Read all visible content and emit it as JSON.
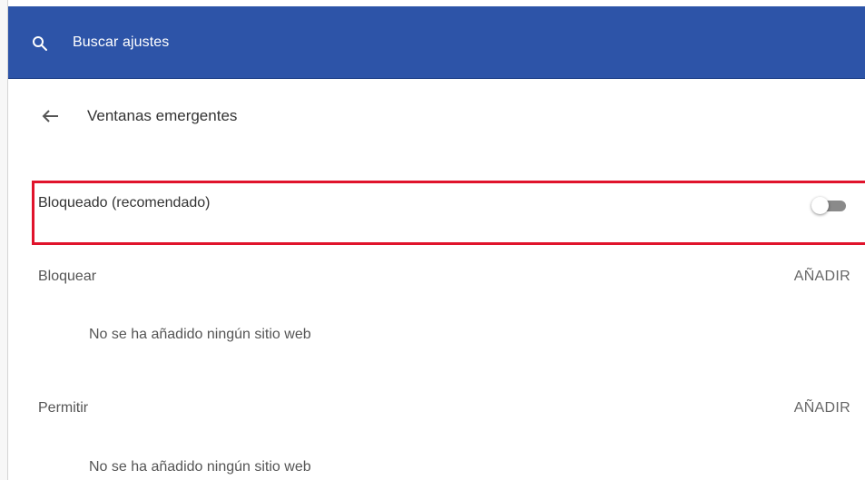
{
  "search": {
    "placeholder": "Buscar ajustes"
  },
  "page": {
    "title": "Ventanas emergentes"
  },
  "setting": {
    "label": "Bloqueado (recomendado)",
    "toggle_on": false
  },
  "sections": [
    {
      "label": "Bloquear",
      "add_label": "AÑADIR",
      "empty_text": "No se ha añadido ningún sitio web"
    },
    {
      "label": "Permitir",
      "add_label": "AÑADIR",
      "empty_text": "No se ha añadido ningún sitio web"
    }
  ],
  "colors": {
    "header": "#2d54a8",
    "highlight": "#e0132b"
  }
}
